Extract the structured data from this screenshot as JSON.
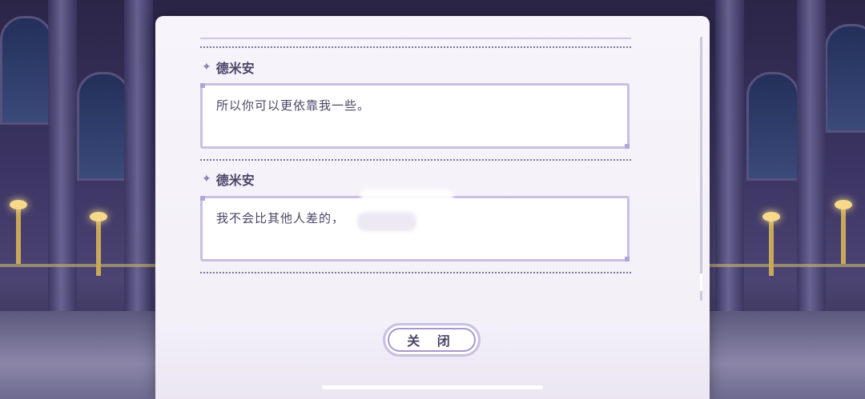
{
  "dialog_log": {
    "entries": [
      {
        "speaker": "德米安",
        "text": "所以你可以更依靠我一些。"
      },
      {
        "speaker": "德米安",
        "text": "我不会比其他人差的，"
      }
    ],
    "close_label": "关 闭",
    "sparkle_icon": "sparkle-icon"
  },
  "colors": {
    "panel": "#f5f2f9",
    "accent_border": "#cbbfe4",
    "text": "#4a4366"
  }
}
